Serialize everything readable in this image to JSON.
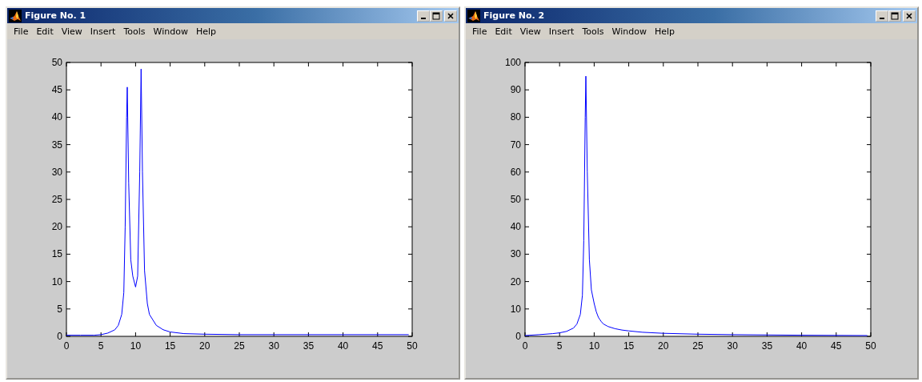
{
  "windows": [
    {
      "title": "Figure No. 1",
      "menu": [
        "File",
        "Edit",
        "View",
        "Insert",
        "Tools",
        "Window",
        "Help"
      ],
      "chart_data": {
        "type": "line",
        "x": [
          0,
          2,
          4,
          5,
          6,
          7,
          7.5,
          8,
          8.3,
          8.5,
          8.7,
          8.8,
          9,
          9.3,
          9.6,
          10,
          10.3,
          10.6,
          10.8,
          11,
          11.3,
          11.7,
          12,
          13,
          14,
          15,
          17,
          20,
          25,
          30,
          40,
          49.5
        ],
        "series": [
          {
            "color": "#0000ff",
            "values": [
              0.2,
              0.2,
              0.2,
              0.3,
              0.6,
              1.2,
              2,
              4,
              8,
              20,
              40,
              45.5,
              28,
              14,
              11,
              9,
              11,
              30,
              48.8,
              30,
              12,
              6,
              4,
              2,
              1.2,
              0.8,
              0.5,
              0.4,
              0.3,
              0.3,
              0.3,
              0.3
            ]
          }
        ],
        "xlim": [
          0,
          50
        ],
        "ylim": [
          0,
          50
        ],
        "xticks": [
          0,
          5,
          10,
          15,
          20,
          25,
          30,
          35,
          40,
          45,
          50
        ],
        "yticks": [
          0,
          5,
          10,
          15,
          20,
          25,
          30,
          35,
          40,
          45,
          50
        ]
      }
    },
    {
      "title": "Figure No. 2",
      "menu": [
        "File",
        "Edit",
        "View",
        "Insert",
        "Tools",
        "Window",
        "Help"
      ],
      "chart_data": {
        "type": "line",
        "x": [
          0,
          2,
          4,
          5,
          6,
          7,
          7.5,
          8,
          8.3,
          8.5,
          8.7,
          8.8,
          9,
          9.3,
          9.6,
          10,
          10.3,
          10.6,
          10.8,
          11,
          11.3,
          11.7,
          12,
          13,
          14,
          15,
          17,
          20,
          25,
          30,
          40,
          49.5
        ],
        "series": [
          {
            "color": "#0000ff",
            "values": [
              0.3,
              0.6,
              1,
              1.3,
              1.8,
              3,
              4.5,
              8,
              15,
              35,
              80,
              95,
              60,
              28,
              17,
              12,
              9,
              7,
              6.2,
              5.5,
              4.6,
              4,
              3.6,
              2.8,
              2.3,
              2,
              1.5,
              1.1,
              0.8,
              0.6,
              0.4,
              0.3
            ]
          }
        ],
        "xlim": [
          0,
          50
        ],
        "ylim": [
          0,
          100
        ],
        "xticks": [
          0,
          5,
          10,
          15,
          20,
          25,
          30,
          35,
          40,
          45,
          50
        ],
        "yticks": [
          0,
          10,
          20,
          30,
          40,
          50,
          60,
          70,
          80,
          90,
          100
        ]
      }
    }
  ]
}
